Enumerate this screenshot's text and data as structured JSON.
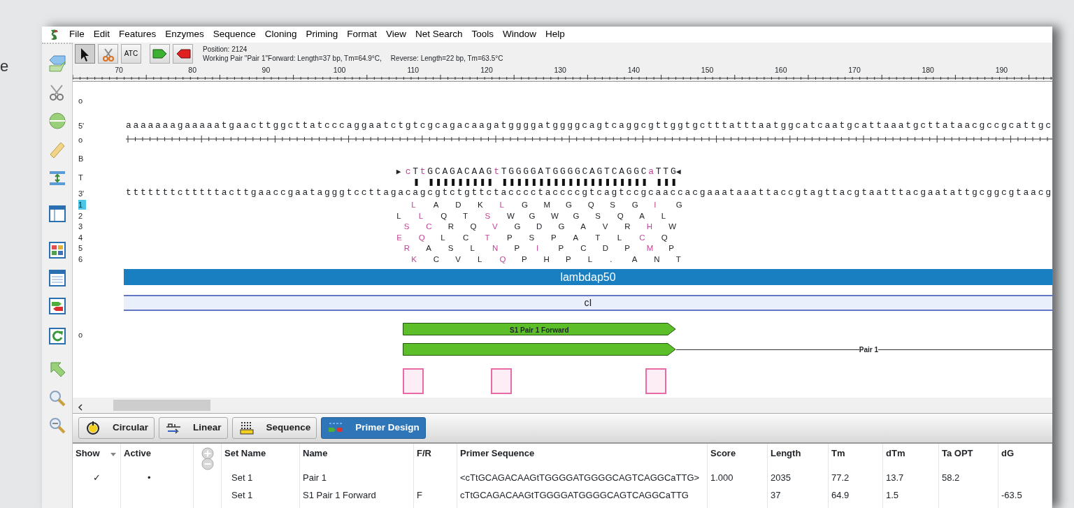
{
  "background_text": "e",
  "menu": [
    "File",
    "Edit",
    "Features",
    "Enzymes",
    "Sequence",
    "Cloning",
    "Priming",
    "Format",
    "View",
    "Net Search",
    "Tools",
    "Window",
    "Help"
  ],
  "toolbar": {
    "tools": [
      {
        "kind": "pointer",
        "selected": true
      },
      {
        "kind": "scissors",
        "selected": false
      },
      {
        "kind": "text",
        "label": "ATC",
        "selected": false
      },
      {
        "kind": "forward",
        "selected": false
      },
      {
        "kind": "reverse",
        "selected": false
      }
    ],
    "position": "Position: 2124",
    "working_pair": "Working Pair \"Pair 1\"Forward: Length=37 bp, Tm=64.9°C,",
    "reverse": "Reverse: Length=22 bp, Tm=63.5°C"
  },
  "ruler": [
    "70",
    "80",
    "90",
    "100",
    "110",
    "120",
    "130",
    "140",
    "150",
    "160",
    "170",
    "180",
    "190"
  ],
  "map": {
    "row_labels": [
      "o",
      "5'",
      "o",
      "B",
      "T",
      "3'",
      "o"
    ],
    "top_strand": "aaaaaaagaaaaatgaacttggcttatcccaggaatctgtcgcagacaagatggggatggggcagtcaggcgttggtgctttatttaatggcatcaatgcattaaatgcttataacgccgcattgc",
    "bottom_strand": "tttttttctttttacttgaaccgaatagggtccttagacagcgtctgttctacccctaccccgtcagtccgcaaccacgaaataaattaccgtagttacgtaatttacgaatattgcggcgtaacg",
    "primer": {
      "start_mark": "▶",
      "sequence": "cTtGCAGACAAGtTGGGGATGGGGCAGTCAGGCaTTG",
      "end_mark": "◀"
    },
    "frames": [
      {
        "label": "1",
        "selected": true,
        "residues": [
          {
            "aa": "L",
            "changed": true
          },
          {
            "aa": "A",
            "changed": false
          },
          {
            "aa": "D",
            "changed": false
          },
          {
            "aa": "K",
            "changed": false
          },
          {
            "aa": "L",
            "changed": true
          },
          {
            "aa": "G",
            "changed": false
          },
          {
            "aa": "M",
            "changed": false
          },
          {
            "aa": "G",
            "changed": false
          },
          {
            "aa": "Q",
            "changed": false
          },
          {
            "aa": "S",
            "changed": false
          },
          {
            "aa": "G",
            "changed": false
          },
          {
            "aa": "I",
            "changed": true
          },
          {
            "aa": "G",
            "changed": false
          }
        ]
      },
      {
        "label": "2",
        "selected": false,
        "residues": [
          {
            "aa": "L",
            "changed": false
          },
          {
            "aa": "L",
            "changed": true
          },
          {
            "aa": "Q",
            "changed": false
          },
          {
            "aa": "T",
            "changed": false
          },
          {
            "aa": "S",
            "changed": true
          },
          {
            "aa": "W",
            "changed": false
          },
          {
            "aa": "G",
            "changed": false
          },
          {
            "aa": "W",
            "changed": false
          },
          {
            "aa": "G",
            "changed": false
          },
          {
            "aa": "S",
            "changed": false
          },
          {
            "aa": "Q",
            "changed": false
          },
          {
            "aa": "A",
            "changed": false
          },
          {
            "aa": "L",
            "changed": false
          }
        ]
      },
      {
        "label": "3",
        "selected": false,
        "residues": [
          {
            "aa": "S",
            "changed": true
          },
          {
            "aa": "C",
            "changed": true
          },
          {
            "aa": "R",
            "changed": false
          },
          {
            "aa": "Q",
            "changed": false
          },
          {
            "aa": "V",
            "changed": true
          },
          {
            "aa": "G",
            "changed": false
          },
          {
            "aa": "D",
            "changed": false
          },
          {
            "aa": "G",
            "changed": false
          },
          {
            "aa": "A",
            "changed": false
          },
          {
            "aa": "V",
            "changed": false
          },
          {
            "aa": "R",
            "changed": false
          },
          {
            "aa": "H",
            "changed": true
          },
          {
            "aa": "W",
            "changed": false
          }
        ]
      },
      {
        "label": "4",
        "selected": false,
        "residues": [
          {
            "aa": "E",
            "changed": true
          },
          {
            "aa": "Q",
            "changed": true
          },
          {
            "aa": "L",
            "changed": false
          },
          {
            "aa": "C",
            "changed": false
          },
          {
            "aa": "T",
            "changed": true
          },
          {
            "aa": "P",
            "changed": false
          },
          {
            "aa": "S",
            "changed": false
          },
          {
            "aa": "P",
            "changed": false
          },
          {
            "aa": "A",
            "changed": false
          },
          {
            "aa": "T",
            "changed": false
          },
          {
            "aa": "L",
            "changed": false
          },
          {
            "aa": "C",
            "changed": true
          },
          {
            "aa": "Q",
            "changed": false
          }
        ]
      },
      {
        "label": "5",
        "selected": false,
        "residues": [
          {
            "aa": "R",
            "changed": true
          },
          {
            "aa": "A",
            "changed": false
          },
          {
            "aa": "S",
            "changed": false
          },
          {
            "aa": "L",
            "changed": false
          },
          {
            "aa": "N",
            "changed": true
          },
          {
            "aa": "P",
            "changed": false
          },
          {
            "aa": "I",
            "changed": true
          },
          {
            "aa": "P",
            "changed": false
          },
          {
            "aa": "C",
            "changed": false
          },
          {
            "aa": "D",
            "changed": false
          },
          {
            "aa": "P",
            "changed": false
          },
          {
            "aa": "M",
            "changed": true
          },
          {
            "aa": "P",
            "changed": false
          }
        ]
      },
      {
        "label": "6",
        "selected": false,
        "residues": [
          {
            "aa": "K",
            "changed": true
          },
          {
            "aa": "C",
            "changed": false
          },
          {
            "aa": "V",
            "changed": false
          },
          {
            "aa": "L",
            "changed": false
          },
          {
            "aa": "Q",
            "changed": true
          },
          {
            "aa": "P",
            "changed": false
          },
          {
            "aa": "H",
            "changed": false
          },
          {
            "aa": "P",
            "changed": false
          },
          {
            "aa": "L",
            "changed": false
          },
          {
            "aa": ".",
            "changed": false
          },
          {
            "aa": "A",
            "changed": false
          },
          {
            "aa": "N",
            "changed": false
          },
          {
            "aa": "T",
            "changed": false
          }
        ]
      }
    ],
    "features": [
      {
        "label": "lambdap50",
        "kind": "solid"
      },
      {
        "label": "cI",
        "kind": "outline"
      }
    ],
    "primer_arrows": [
      {
        "kind": "primer",
        "label": "S1 Pair 1 Forward"
      },
      {
        "kind": "pair",
        "label": "Pair 1"
      }
    ]
  },
  "tabs": [
    {
      "label": "Circular",
      "selected": false
    },
    {
      "label": "Linear",
      "selected": false
    },
    {
      "label": "Sequence",
      "selected": false
    },
    {
      "label": "Primer Design",
      "selected": true
    }
  ],
  "table": {
    "columns": [
      "Show",
      "Active",
      "",
      "Set Name",
      "Name",
      "F/R",
      "Primer Sequence",
      "Score",
      "Length",
      "Tm",
      "dTm",
      "Ta OPT",
      "dG"
    ],
    "rows": [
      {
        "cells": [
          "✓",
          "•",
          "",
          "Set 1",
          "Pair 1",
          "",
          "<cTtGCAGACAAGtTGGGGATGGGGCAGTCAGGCaTTG>",
          "1.000",
          "2035",
          "77.2",
          "13.7",
          "58.2",
          ""
        ]
      },
      {
        "cells": [
          "",
          "",
          "",
          "Set 1",
          "S1 Pair 1 Forward",
          "F",
          "cTtGCAGACAAGtTGGGGATGGGGCAGTCAGGCaTTG",
          "",
          "37",
          "64.9",
          "1.5",
          "",
          "-63.5"
        ]
      }
    ]
  }
}
